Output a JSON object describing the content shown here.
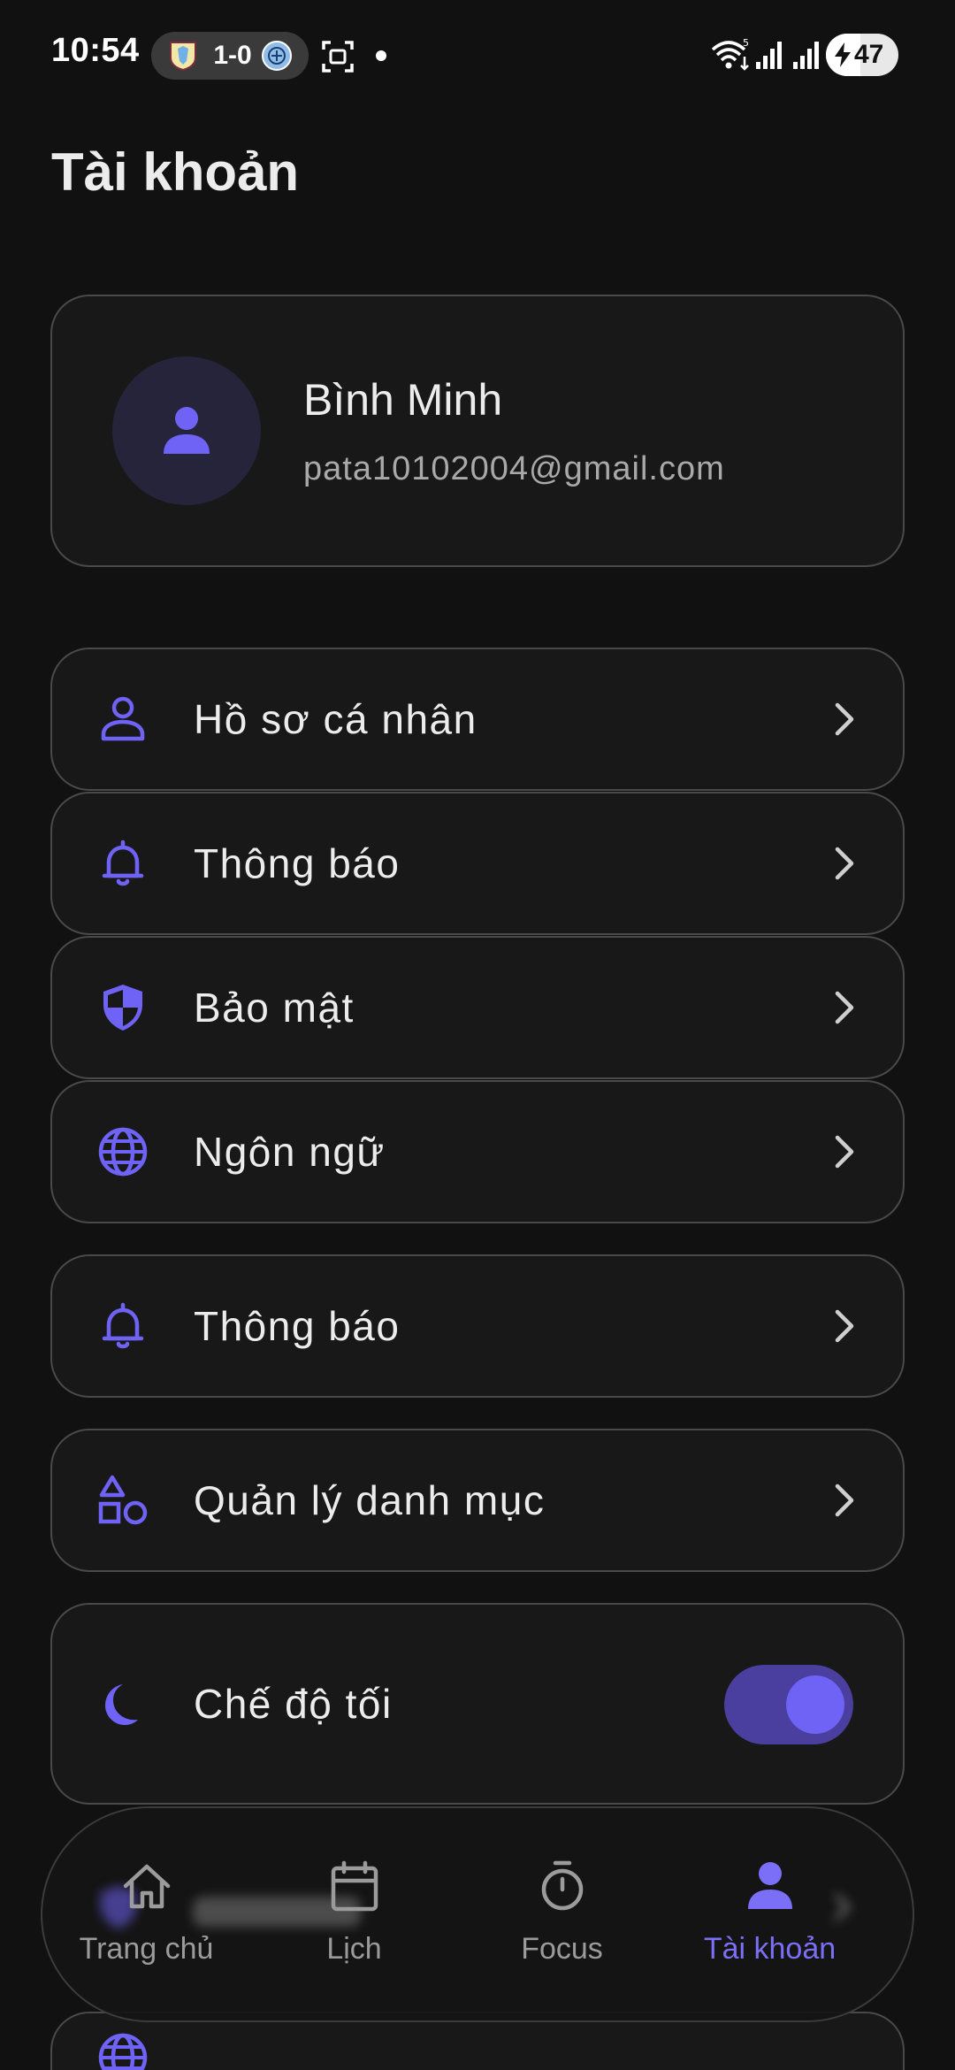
{
  "status_bar": {
    "time": "10:54",
    "score": "1-0",
    "battery_level": 47,
    "battery_text": "47"
  },
  "header": {
    "title": "Tài khoản"
  },
  "profile": {
    "name": "Bình Minh",
    "email": "pata10102004@gmail.com"
  },
  "menu": {
    "profile_label": "Hồ sơ cá nhân",
    "notifications_label": "Thông báo",
    "security_label": "Bảo mật",
    "language_label": "Ngôn ngữ",
    "notifications2_label": "Thông báo",
    "categories_label": "Quản lý danh mục",
    "dark_mode_label": "Chế độ tối",
    "dark_mode_on": true
  },
  "bottom_nav": {
    "items": [
      {
        "label": "Trang chủ",
        "icon": "home-icon"
      },
      {
        "label": "Lịch",
        "icon": "calendar-icon"
      },
      {
        "label": "Focus",
        "icon": "timer-icon"
      },
      {
        "label": "Tài khoản",
        "icon": "account-icon",
        "active": true
      }
    ]
  },
  "colors": {
    "accent": "#6f63f6",
    "background": "#111111",
    "card": "#181818",
    "card_border": "#4a4a4a",
    "text_primary": "#ececec",
    "text_secondary": "#a9a9a9",
    "toggle_track": "#4a3f9e"
  }
}
